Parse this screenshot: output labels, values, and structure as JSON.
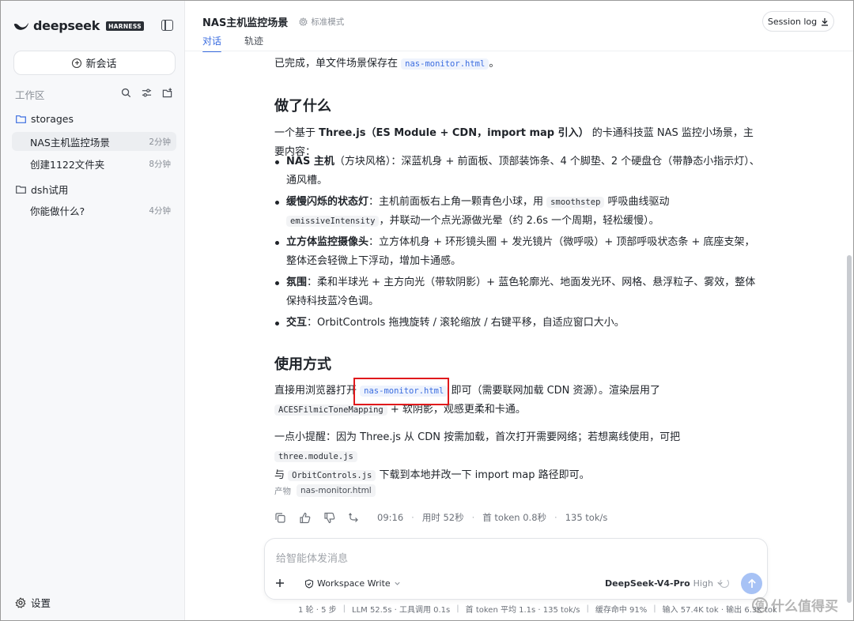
{
  "sidebar": {
    "logo_text": "deepseek",
    "logo_badge": "HARNESS",
    "new_chat_label": "新会话",
    "workspace_label": "工作区",
    "folders": [
      {
        "name": "storages",
        "items": [
          {
            "label": "NAS主机监控场景",
            "time": "2分钟",
            "active": true
          },
          {
            "label": "创建1122文件夹",
            "time": "8分钟",
            "active": false
          }
        ]
      },
      {
        "name": "dsh试用",
        "items": [
          {
            "label": "你能做什么?",
            "time": "4分钟",
            "active": false
          }
        ]
      }
    ],
    "settings_label": "设置"
  },
  "header": {
    "title": "NAS主机监控场景",
    "mode_label": "标准模式",
    "tabs": [
      "对话",
      "轨迹"
    ],
    "session_log_label": "Session log"
  },
  "message": {
    "intro_prefix": "已完成，单文件场景保存在",
    "intro_file": "nas-monitor.html",
    "intro_suffix": "。",
    "h_what": "做了什么",
    "what_p_prefix": "一个基于",
    "what_p_bold": "Three.js（ES Module + CDN，import map 引入）",
    "what_p_suffix": "的卡通科技蓝 NAS 监控小场景，主要内容：",
    "bullets": [
      {
        "bold": "NAS 主机",
        "text": "（方块风格）：深蓝机身 + 前面板、顶部装饰条、4 个脚垫、2 个硬盘仓（带静态小指示灯）、通风槽。"
      },
      {
        "bold": "缓慢闪烁的状态灯",
        "text_a": "：主机前面板右上角一颗青色小球，用",
        "code_a": "smoothstep",
        "text_b": "呼吸曲线驱动",
        "code_b": "emissiveIntensity",
        "text_c": "，并联动一个点光源做光晕（约 2.6s 一个周期，轻松缓慢）。"
      },
      {
        "bold": "立方体监控摄像头",
        "text": "：立方体机身 + 环形镜头圈 + 发光镜片（微呼吸）+ 顶部呼吸状态条 + 底座支架，整体还会轻微上下浮动，增加卡通感。"
      },
      {
        "bold": "氛围",
        "text": "：柔和半球光 + 主方向光（带软阴影）+ 蓝色轮廓光、地面发光环、网格、悬浮粒子、雾效，整体保持科技蓝冷色调。"
      },
      {
        "bold": "交互",
        "text": "：OrbitControls 拖拽旋转 / 滚轮缩放 / 右键平移，自适应窗口大小。"
      }
    ],
    "h_usage": "使用方式",
    "usage_prefix": "直接用浏览器打开",
    "usage_file": "nas-monitor.html",
    "usage_mid": "即可（需要联网加载 CDN 资源）。渲染层用了",
    "usage_code": "ACESFilmicToneMapping",
    "usage_suffix": "+ 软阴影，观感更柔和卡通。",
    "tip_prefix": "一点小提醒：因为 Three.js 从 CDN 按需加载，首次打开需要网络；若想离线使用，可把",
    "tip_code_a": "three.module.js",
    "tip_and": "与",
    "tip_code_b": "OrbitControls.js",
    "tip_suffix": "下载到本地并改一下 import map 路径即可。",
    "product_label": "产物",
    "product_file": "nas-monitor.html",
    "time": "09:16",
    "duration": "用时 52秒",
    "first_token": "首 token 0.8秒",
    "speed": "135 tok/s"
  },
  "composer": {
    "placeholder": "给智能体发消息",
    "workspace_mode": "Workspace Write",
    "model": "DeepSeek-V4-Pro",
    "level": "High"
  },
  "stats": [
    "1 轮 · 5 步",
    "LLM 52.5s · 工具调用 0.1s",
    "首 token 平均 1.1s · 135 tok/s",
    "缓存命中 91%",
    "输入 57.4K tok · 输出 6.3K tok"
  ],
  "watermark": "什么值得买",
  "colors": {
    "accent": "#3b6de0",
    "highlight_box": "#e0191c",
    "send_button": "#a7c2f5"
  }
}
